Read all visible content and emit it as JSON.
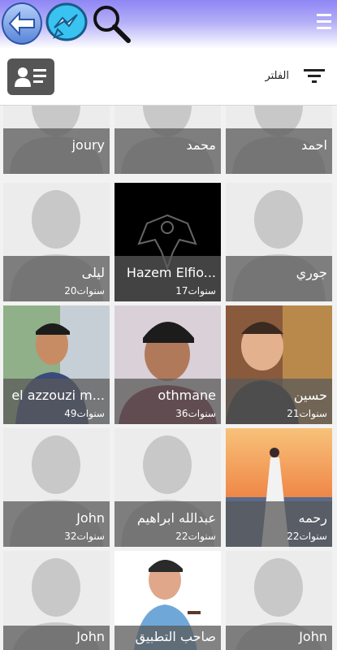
{
  "header": {
    "menu_icon": "hamburger-icon",
    "back_icon": "back-arrow-icon",
    "messenger_icon": "messenger-icon",
    "search_icon": "search-icon"
  },
  "filter": {
    "label": "الفلتر"
  },
  "colors": {
    "topbar": "#8f86f5",
    "overlay": "#5a5a5a"
  },
  "cards": [
    {
      "name": "احمد",
      "age": ""
    },
    {
      "name": "محمد",
      "age": ""
    },
    {
      "name": "joury",
      "age": ""
    },
    {
      "name": "جوري",
      "age": ""
    },
    {
      "name": "Hazem Elfio...",
      "age": "17سنوات"
    },
    {
      "name": "ليلى",
      "age": "20سنوات"
    },
    {
      "name": "حسين",
      "age": "21سنوات"
    },
    {
      "name": "othmane",
      "age": "36سنوات"
    },
    {
      "name": "el azzouzi m...",
      "age": "49سنوات"
    },
    {
      "name": "رحمه",
      "age": "22سنوات"
    },
    {
      "name": "عبدالله ابراهيم",
      "age": "22سنوات"
    },
    {
      "name": "John",
      "age": "32سنوات"
    },
    {
      "name": "John",
      "age": ""
    },
    {
      "name": "صاحب التطبيق",
      "age": ""
    },
    {
      "name": "John",
      "age": ""
    }
  ]
}
